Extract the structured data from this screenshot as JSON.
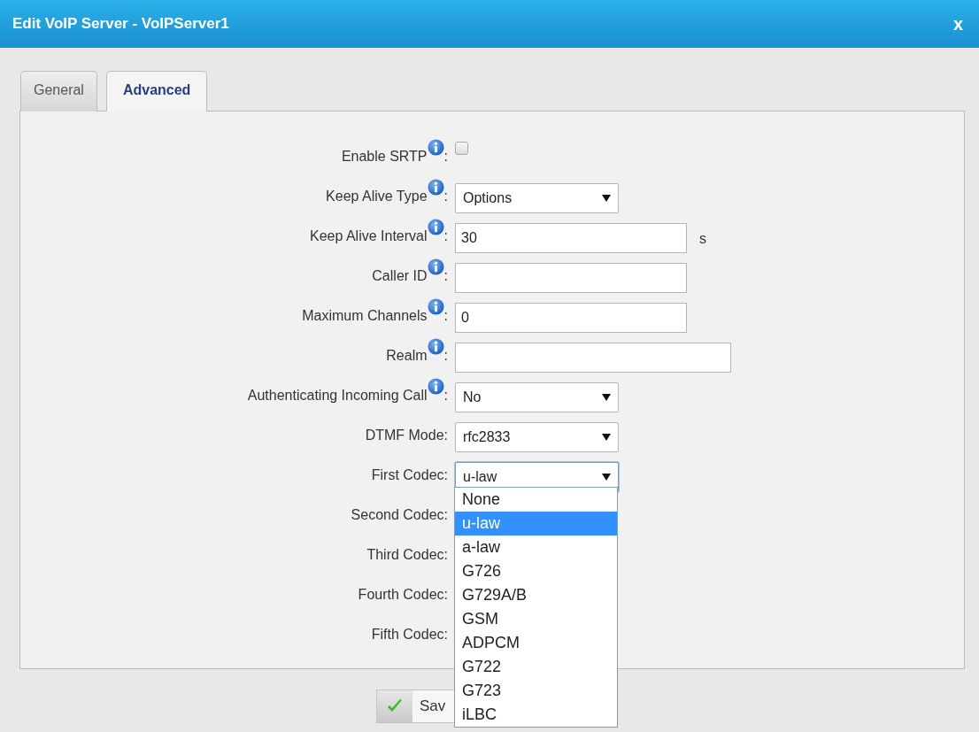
{
  "window": {
    "title": "Edit VoIP Server - VoIPServer1",
    "close": "x"
  },
  "tabs": [
    {
      "label": "General",
      "selected": false
    },
    {
      "label": "Advanced",
      "selected": true
    }
  ],
  "fields": [
    {
      "kind": "checkbox",
      "label": "Enable SRTP",
      "info": true,
      "separator": ":",
      "checked": false
    },
    {
      "kind": "select",
      "label": "Keep Alive Type",
      "info": true,
      "separator": ":",
      "value": "Options"
    },
    {
      "kind": "text",
      "label": "Keep Alive Interval",
      "info": true,
      "separator": ":",
      "value": "30",
      "unit": "s"
    },
    {
      "kind": "text",
      "label": "Caller ID",
      "info": true,
      "separator": ":"
    },
    {
      "kind": "text",
      "label": "Maximum Channels",
      "info": true,
      "separator": ":",
      "value": "0"
    },
    {
      "kind": "wide-text",
      "label": "Realm",
      "info": true,
      "separator": ":"
    },
    {
      "kind": "select",
      "label": "Authenticating Incoming Call",
      "info": true,
      "separator": ":",
      "value": "No"
    },
    {
      "kind": "select",
      "label": "DTMF Mode:",
      "info": false,
      "value": "rfc2833"
    },
    {
      "kind": "select",
      "label": "First Codec:",
      "info": false,
      "value": "u-law",
      "focused": true
    },
    {
      "kind": "hidden",
      "label": "Second Codec:",
      "info": false
    },
    {
      "kind": "hidden",
      "label": "Third Codec:",
      "info": false
    },
    {
      "kind": "hidden",
      "label": "Fourth Codec:",
      "info": false
    },
    {
      "kind": "hidden",
      "label": "Fifth Codec:",
      "info": false
    }
  ],
  "dropdown": {
    "options": [
      {
        "label": "None",
        "selected": false
      },
      {
        "label": "u-law",
        "selected": true
      },
      {
        "label": "a-law",
        "selected": false
      },
      {
        "label": "G726",
        "selected": false
      },
      {
        "label": "G729A/B",
        "selected": false
      },
      {
        "label": "GSM",
        "selected": false
      },
      {
        "label": "ADPCM",
        "selected": false
      },
      {
        "label": "G722",
        "selected": false
      },
      {
        "label": "G723",
        "selected": false
      },
      {
        "label": "iLBC",
        "selected": false
      }
    ]
  },
  "save_button": {
    "label": "Sav"
  }
}
